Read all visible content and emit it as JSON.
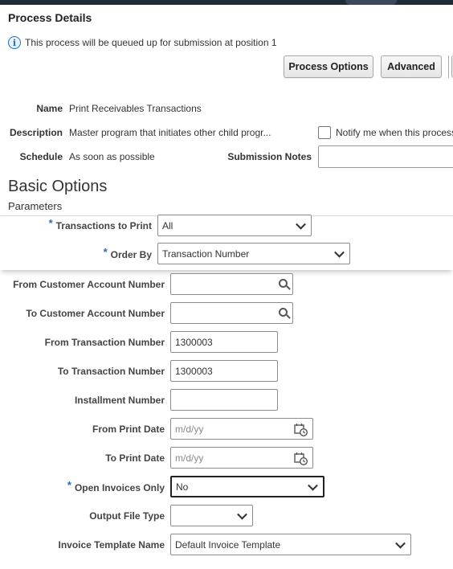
{
  "page": {
    "title": "Process Details",
    "info_message": "This process will be queued up for submission at position 1"
  },
  "toolbar": {
    "process_options_label": "Process Options",
    "advanced_label": "Advanced"
  },
  "details": {
    "name_label": "Name",
    "name_value": "Print Receivables Transactions",
    "description_label": "Description",
    "description_value": "Master program that initiates other child progr...",
    "schedule_label": "Schedule",
    "schedule_value": "As soon as possible",
    "notify_label": "Notify me when this process",
    "submission_notes_label": "Submission Notes"
  },
  "basic_options": {
    "title": "Basic Options",
    "parameters_label": "Parameters"
  },
  "params": {
    "transactions_to_print": {
      "label": "Transactions to Print",
      "required": "*",
      "value": "All"
    },
    "order_by": {
      "label": "Order By",
      "required": "*",
      "value": "Transaction Number"
    },
    "from_customer_account": {
      "label": "From Customer Account Number",
      "value": ""
    },
    "to_customer_account": {
      "label": "To Customer Account Number",
      "value": ""
    },
    "from_transaction": {
      "label": "From Transaction Number",
      "value": "1300003"
    },
    "to_transaction": {
      "label": "To Transaction Number",
      "value": "1300003"
    },
    "installment_number": {
      "label": "Installment Number",
      "value": ""
    },
    "from_print_date": {
      "label": "From Print Date",
      "placeholder": "m/d/yy"
    },
    "to_print_date": {
      "label": "To Print Date",
      "placeholder": "m/d/yy"
    },
    "open_invoices_only": {
      "label": "Open Invoices Only",
      "required": "*",
      "value": "No"
    },
    "output_file_type": {
      "label": "Output File Type",
      "value": ""
    },
    "invoice_template_name": {
      "label": "Invoice Template Name",
      "value": "Default Invoice Template"
    }
  },
  "colors": {
    "required_marker": "#1b6fc1",
    "top_bar": "#1e2c3a"
  }
}
